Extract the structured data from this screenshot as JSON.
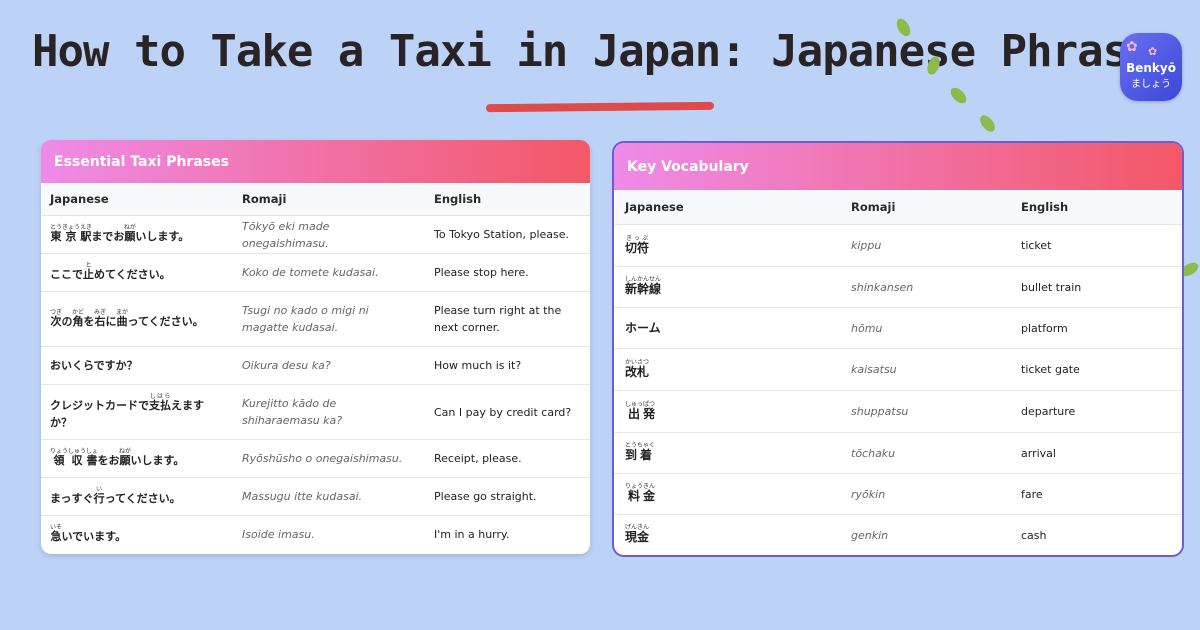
{
  "title": "How to Take a Taxi in Japan: Japanese Phrases",
  "logo": {
    "brand": "Benkyō",
    "sub": "ましょう"
  },
  "colors": {
    "background": "#bcd3f7",
    "header_start": "#ee8be8",
    "header_end": "#f35866",
    "underline": "#dd4b4b"
  },
  "phrases": {
    "heading": "Essential Taxi Phrases",
    "columns": [
      "Japanese",
      "Romaji",
      "English"
    ],
    "rows": [
      {
        "jp": [
          {
            "b": "東",
            "r": "とう"
          },
          {
            "b": "京",
            "r": "きょう"
          },
          {
            "b": "駅",
            "r": "えき"
          },
          {
            "t": "まで"
          },
          {
            "t": "お"
          },
          {
            "b": "願",
            "r": "ねが"
          },
          {
            "t": "いします。"
          }
        ],
        "romaji": "Tōkyō eki made onegaishimasu.",
        "en": "To Tokyo Station, please."
      },
      {
        "jp": [
          {
            "t": "ここで"
          },
          {
            "b": "止",
            "r": "と"
          },
          {
            "t": "めてください。"
          }
        ],
        "romaji": "Koko de tomete kudasai.",
        "en": "Please stop here."
      },
      {
        "jp": [
          {
            "b": "次",
            "r": "つぎ"
          },
          {
            "t": "の"
          },
          {
            "b": "角",
            "r": "かど"
          },
          {
            "t": "を"
          },
          {
            "b": "右",
            "r": "みぎ"
          },
          {
            "t": "に"
          },
          {
            "b": "曲",
            "r": "まが"
          },
          {
            "t": "ってください。"
          }
        ],
        "romaji": "Tsugi no kado o migi ni magatte kudasai.",
        "en": "Please turn right at the next corner."
      },
      {
        "jp": [
          {
            "t": "おいくらですか？"
          }
        ],
        "romaji": "Oikura desu ka?",
        "en": "How much is it?"
      },
      {
        "jp": [
          {
            "t": "クレジットカードで"
          },
          {
            "b": "支払",
            "r": "しはら"
          },
          {
            "t": "えますか？"
          }
        ],
        "romaji": "Kurejitto kādo de shiharaemasu ka?",
        "en": "Can I pay by credit card?"
      },
      {
        "jp": [
          {
            "b": "領",
            "r": "りょう"
          },
          {
            "b": "収",
            "r": "しゅう"
          },
          {
            "b": "書",
            "r": "しょ"
          },
          {
            "t": "を"
          },
          {
            "t": "お"
          },
          {
            "b": "願",
            "r": "ねが"
          },
          {
            "t": "いします。"
          }
        ],
        "romaji": "Ryōshūsho o onegaishimasu.",
        "en": "Receipt, please."
      },
      {
        "jp": [
          {
            "t": "まっすぐ"
          },
          {
            "b": "行",
            "r": "い"
          },
          {
            "t": "ってください。"
          }
        ],
        "romaji": "Massugu itte kudasai.",
        "en": "Please go straight."
      },
      {
        "jp": [
          {
            "b": "急",
            "r": "いそ"
          },
          {
            "t": "いでいます。"
          }
        ],
        "romaji": "Isoide imasu.",
        "en": "I'm in a hurry."
      }
    ]
  },
  "vocab": {
    "heading": "Key Vocabulary",
    "columns": [
      "Japanese",
      "Romaji",
      "English"
    ],
    "rows": [
      {
        "jp": [
          {
            "b": "切符",
            "r": "きっぷ"
          }
        ],
        "romaji": "kippu",
        "en": "ticket"
      },
      {
        "jp": [
          {
            "b": "新",
            "r": "しん"
          },
          {
            "b": "幹",
            "r": "かん"
          },
          {
            "b": "線",
            "r": "せん"
          }
        ],
        "romaji": "shinkansen",
        "en": "bullet train"
      },
      {
        "jp": [
          {
            "t": "ホーム"
          }
        ],
        "romaji": "hōmu",
        "en": "platform"
      },
      {
        "jp": [
          {
            "b": "改",
            "r": "かい"
          },
          {
            "b": "札",
            "r": "さつ"
          }
        ],
        "romaji": "kaisatsu",
        "en": "ticket gate"
      },
      {
        "jp": [
          {
            "b": "出",
            "r": "しゅっ"
          },
          {
            "b": "発",
            "r": "ぱつ"
          }
        ],
        "romaji": "shuppatsu",
        "en": "departure"
      },
      {
        "jp": [
          {
            "b": "到",
            "r": "とう"
          },
          {
            "b": "着",
            "r": "ちゃく"
          }
        ],
        "romaji": "tōchaku",
        "en": "arrival"
      },
      {
        "jp": [
          {
            "b": "料",
            "r": "りょう"
          },
          {
            "b": "金",
            "r": "きん"
          }
        ],
        "romaji": "ryōkin",
        "en": "fare"
      },
      {
        "jp": [
          {
            "b": "現",
            "r": "げん"
          },
          {
            "b": "金",
            "r": "きん"
          }
        ],
        "romaji": "genkin",
        "en": "cash"
      }
    ]
  }
}
